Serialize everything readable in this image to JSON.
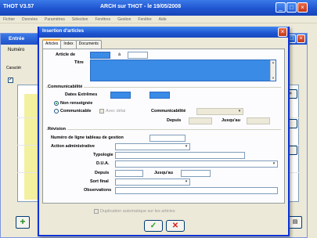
{
  "app": {
    "title_left": "THOT V3.57",
    "title_center": "ARCH sur THOT - le 19/05/2008",
    "menu": [
      "Fichier",
      "Données",
      "Paramètres",
      "Sélection",
      "Fenêtres",
      "Gestion",
      "Fenêtre",
      "Aide"
    ]
  },
  "inner_window": {
    "title": "Entrée",
    "numero_label": "Numéro",
    "caracteristiques_label": "Caractér"
  },
  "dialog": {
    "title": "Insertion d'articles",
    "close_label": "×",
    "tabs": [
      "Articles",
      "Index",
      "Documents"
    ],
    "article": {
      "article_de_label": "Article de",
      "article_a_label": "à",
      "titre_label": "Titre"
    },
    "communicabilite": {
      "section_title": "Communicabilité",
      "dates_extremes_label": "Dates Extrêmes",
      "non_renseignee_label": "Non renseignée",
      "communicable_label": "Communicable",
      "avec_delai_label": "Avec délai",
      "communicabilite_label": "Communicabilité",
      "depuis_label": "Depuis",
      "jusqu_au_label": "Jusqu'au"
    },
    "revision": {
      "section_title": "Révision",
      "numero_ligne_label": "Numéro de ligne tableau de gestion",
      "action_admin_label": "Action administrative",
      "typologie_label": "Typologie",
      "dua_label": "D.U.A.",
      "depuis_label": "Depuis",
      "jusqu_au_label": "Jusqu'au",
      "sort_final_label": "Sort final",
      "observations_label": "Observations"
    },
    "duplication_label": "Duplication automatique sur les articles",
    "ok_label": "✓",
    "cancel_label": "✕"
  },
  "icons": {
    "minimize": "minimize-icon",
    "maximize": "maximize-icon",
    "close": "close-icon",
    "add": "add-icon",
    "ok": "checkmark-icon",
    "cancel": "cross-icon"
  },
  "colors": {
    "titlebar": "#1f55d0",
    "field_highlight": "#3a8be6",
    "ok_green": "#27a327",
    "cancel_red": "#d8201c"
  }
}
